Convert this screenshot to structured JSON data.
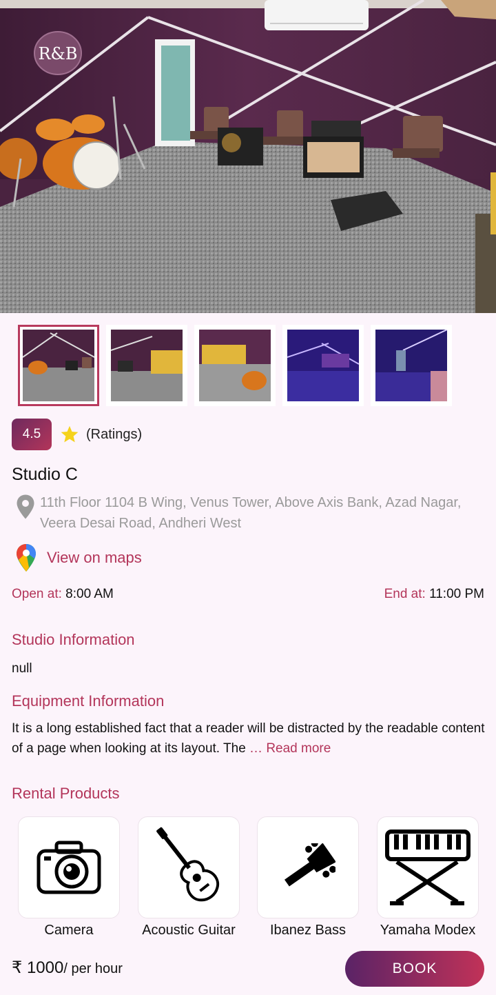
{
  "thumbnails": [
    {
      "name": "studio-photo-1",
      "active": true
    },
    {
      "name": "studio-photo-2",
      "active": false
    },
    {
      "name": "studio-photo-3",
      "active": false
    },
    {
      "name": "studio-photo-4",
      "active": false
    },
    {
      "name": "studio-photo-5",
      "active": false
    }
  ],
  "hero": {
    "logo_text": "R&B"
  },
  "rating": {
    "value": "4.5",
    "label": "(Ratings)",
    "icon": "star-icon"
  },
  "studio": {
    "title": "Studio C",
    "address": "11th Floor 1104 B Wing, Venus Tower, Above Axis Bank, Azad Nagar, Veera Desai Road, Andheri West"
  },
  "maps": {
    "label": "View on maps",
    "icon": "google-maps-pin-icon"
  },
  "hours": {
    "open_label": "Open at:",
    "open_value": "8:00 AM",
    "end_label": "End at:",
    "end_value": "11:00 PM"
  },
  "studio_info": {
    "heading": "Studio Information",
    "text": "null"
  },
  "equipment_info": {
    "heading": "Equipment Information",
    "text": "It is a long established fact that a reader will be distracted by the readable content of a page when looking at its layout. The",
    "read_more": "… Read more"
  },
  "rental": {
    "heading": "Rental Products",
    "items": [
      {
        "label": "Camera",
        "icon": "camera-icon"
      },
      {
        "label": "Acoustic Guitar",
        "icon": "acoustic-guitar-icon"
      },
      {
        "label": "Ibanez Bass",
        "icon": "bass-headstock-icon"
      },
      {
        "label": "Yamaha Modex",
        "icon": "keyboard-stand-icon"
      }
    ]
  },
  "footer": {
    "currency": "₹",
    "price": "1000",
    "unit": "/ per hour",
    "book_label": "BOOK"
  },
  "colors": {
    "accent": "#b3355a",
    "background": "#fcf4fb",
    "wall": "#4a2340",
    "carpet": "#8f8f8f"
  }
}
